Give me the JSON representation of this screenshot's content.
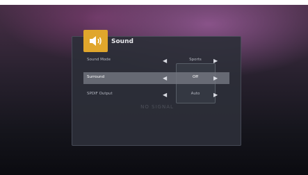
{
  "menu": {
    "title": "Sound",
    "icon": "speaker-icon",
    "accent_color": "#e0a62c",
    "items": [
      {
        "label": "Sound Mode",
        "value": "Sports"
      },
      {
        "label": "Surround",
        "value": "Off",
        "selected": true
      },
      {
        "label": "SPDIF Output",
        "value": "Auto"
      }
    ],
    "arrow_left": "◀",
    "arrow_right": "▶"
  },
  "watermark": "NO SIGNAL"
}
